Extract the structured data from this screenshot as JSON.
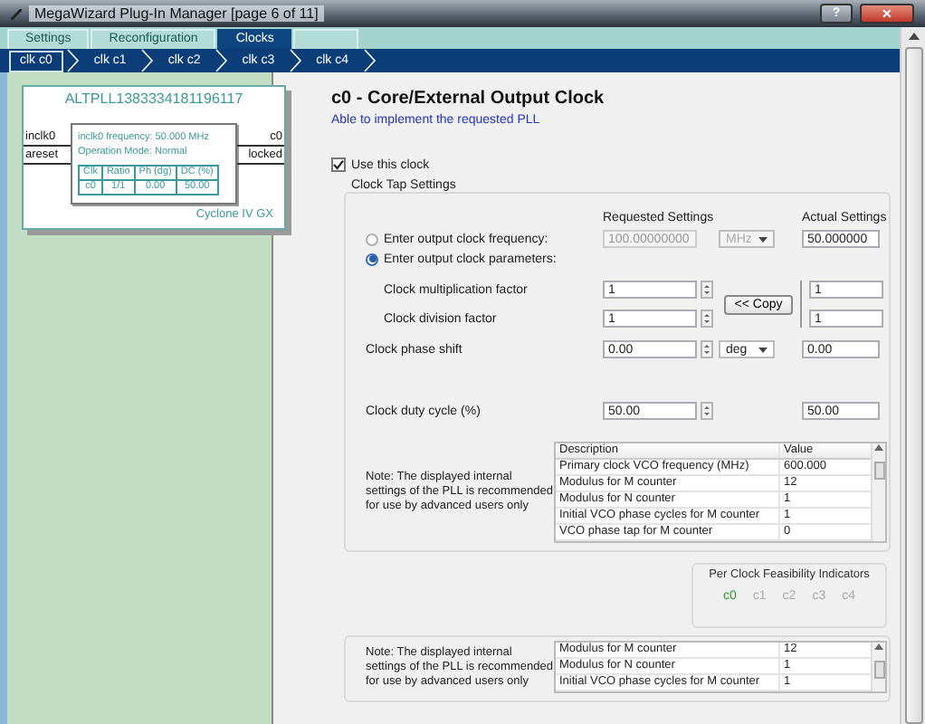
{
  "window": {
    "title": "MegaWizard Plug-In Manager [page 6 of 11]",
    "buttons": [
      {
        "kind": "help",
        "label": "?"
      },
      {
        "kind": "close",
        "label": "✕"
      }
    ]
  },
  "tabs": [
    {
      "label": "Settings",
      "selected": false
    },
    {
      "label": "Reconfiguration",
      "selected": false
    },
    {
      "label": "Clocks",
      "selected": true
    }
  ],
  "clock_tabs": [
    {
      "label": "clk c0",
      "selected": true
    },
    {
      "label": "clk c1",
      "selected": false
    },
    {
      "label": "clk c2",
      "selected": false
    },
    {
      "label": "clk c3",
      "selected": false
    },
    {
      "label": "clk c4",
      "selected": false
    }
  ],
  "diagram": {
    "title": "ALTPLL1383334181196117",
    "inputs": [
      "inclk0",
      "areset"
    ],
    "outputs": [
      "c0",
      "locked"
    ],
    "info": [
      "inclk0 frequency: 50.000 MHz",
      "Operation Mode: Normal"
    ],
    "table": {
      "columns": [
        "Clk",
        "Ratio",
        "Ph (dg)",
        "DC (%)"
      ],
      "rows": [
        [
          "c0",
          "1/1",
          "0.00",
          "50.00"
        ]
      ]
    },
    "device": "Cyclone IV GX"
  },
  "clock": {
    "title": "c0 - Core/External Output Clock",
    "status": "Able to implement the requested PLL",
    "use_clock": {
      "label": "Use this clock",
      "checked": true
    },
    "group_title": "Clock Tap Settings",
    "requested_header": "Requested Settings",
    "actual_header": "Actual Settings",
    "modes": [
      {
        "label": "Enter output clock frequency:",
        "selected": false,
        "value": "100.00000000",
        "unit": "MHz",
        "disabled": true,
        "actual": "50.000000"
      },
      {
        "label": "Enter output clock parameters:",
        "selected": true
      }
    ],
    "factors": [
      {
        "label": "Clock multiplication factor",
        "value": "1",
        "actual": "1"
      },
      {
        "label": "Clock division factor",
        "value": "1",
        "actual": "1"
      }
    ],
    "copy_button": "<< Copy",
    "settings": [
      {
        "label": "Clock phase shift",
        "value": "0.00",
        "unit": "deg",
        "actual": "0.00"
      },
      {
        "label": "Clock duty cycle (%)",
        "value": "50.00",
        "actual": "50.00"
      }
    ]
  },
  "internal_tables": [
    {
      "note": "Note: The displayed internal settings of the PLL is recommended for use by advanced users only",
      "columns": [
        "Description",
        "Value"
      ],
      "rows": [
        [
          "Primary clock VCO frequency (MHz)",
          "600.000"
        ],
        [
          "Modulus for M counter",
          "12"
        ],
        [
          "Modulus for N counter",
          "1"
        ],
        [
          "Initial VCO phase cycles for M counter",
          "1"
        ],
        [
          "VCO phase tap for M counter",
          "0"
        ]
      ]
    },
    {
      "note": "Note: The displayed internal settings of the PLL is recommended for use by advanced users only",
      "rows": [
        [
          "Modulus for M counter",
          "12"
        ],
        [
          "Modulus for N counter",
          "1"
        ],
        [
          "Initial VCO phase cycles for M counter",
          "1"
        ]
      ]
    }
  ],
  "feasibility": {
    "title": "Per Clock Feasibility Indicators",
    "clocks": [
      {
        "label": "c0",
        "feasible": true
      },
      {
        "label": "c1",
        "feasible": false
      },
      {
        "label": "c2",
        "feasible": false
      },
      {
        "label": "c3",
        "feasible": false
      },
      {
        "label": "c4",
        "feasible": false
      }
    ]
  }
}
